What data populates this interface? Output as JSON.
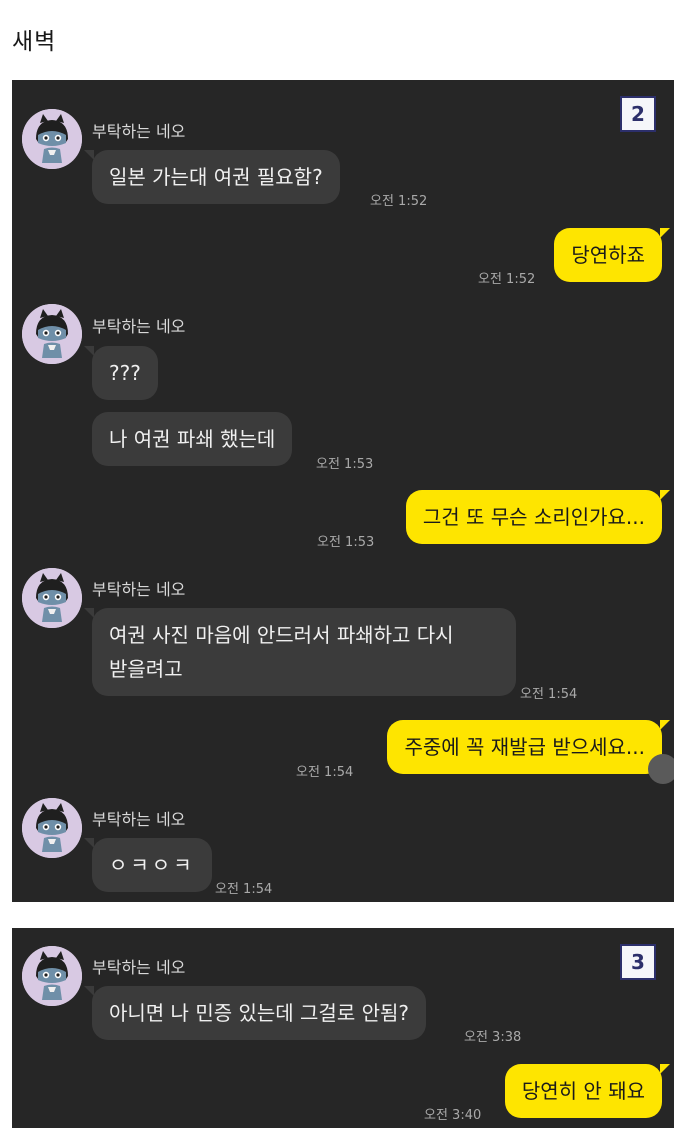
{
  "page": {
    "title": "새벽"
  },
  "panels": [
    {
      "badge": "2",
      "messages": [
        {
          "sender": "부탁하는 네오",
          "text": "일본 가는대 여권 필요함?",
          "time": "오전 1:52"
        },
        {
          "text": "당연하죠",
          "time": "오전 1:52"
        },
        {
          "sender": "부탁하는 네오",
          "text": "???"
        },
        {
          "text": "나 여권 파쇄 했는데",
          "time": "오전 1:53"
        },
        {
          "text": "그건 또 무슨 소리인가요...",
          "time": "오전 1:53"
        },
        {
          "sender": "부탁하는 네오",
          "line1": "여권 사진 마음에 안드러서 파쇄하고 다시",
          "line2": "받을려고",
          "time": "오전 1:54"
        },
        {
          "text": "주중에 꼭 재발급 받으세요...",
          "time": "오전 1:54"
        },
        {
          "sender": "부탁하는 네오",
          "text": "ㅇㅋㅇㅋ",
          "time": "오전 1:54"
        }
      ]
    },
    {
      "badge": "3",
      "messages": [
        {
          "sender": "부탁하는 네오",
          "text": "아니면 나 민증 있는데 그걸로 안됨?",
          "time": "오전 3:38"
        },
        {
          "text": "당연히 안 돼요",
          "time": "오전 3:40"
        }
      ]
    }
  ],
  "icons": {
    "avatar": "neo-avatar-icon"
  },
  "colors": {
    "panel_bg": "#262626",
    "incoming_bubble": "#3b3b3b",
    "outgoing_bubble": "#fee500",
    "timestamp": "#a9a9a9",
    "badge_border": "#2c2f6b"
  }
}
